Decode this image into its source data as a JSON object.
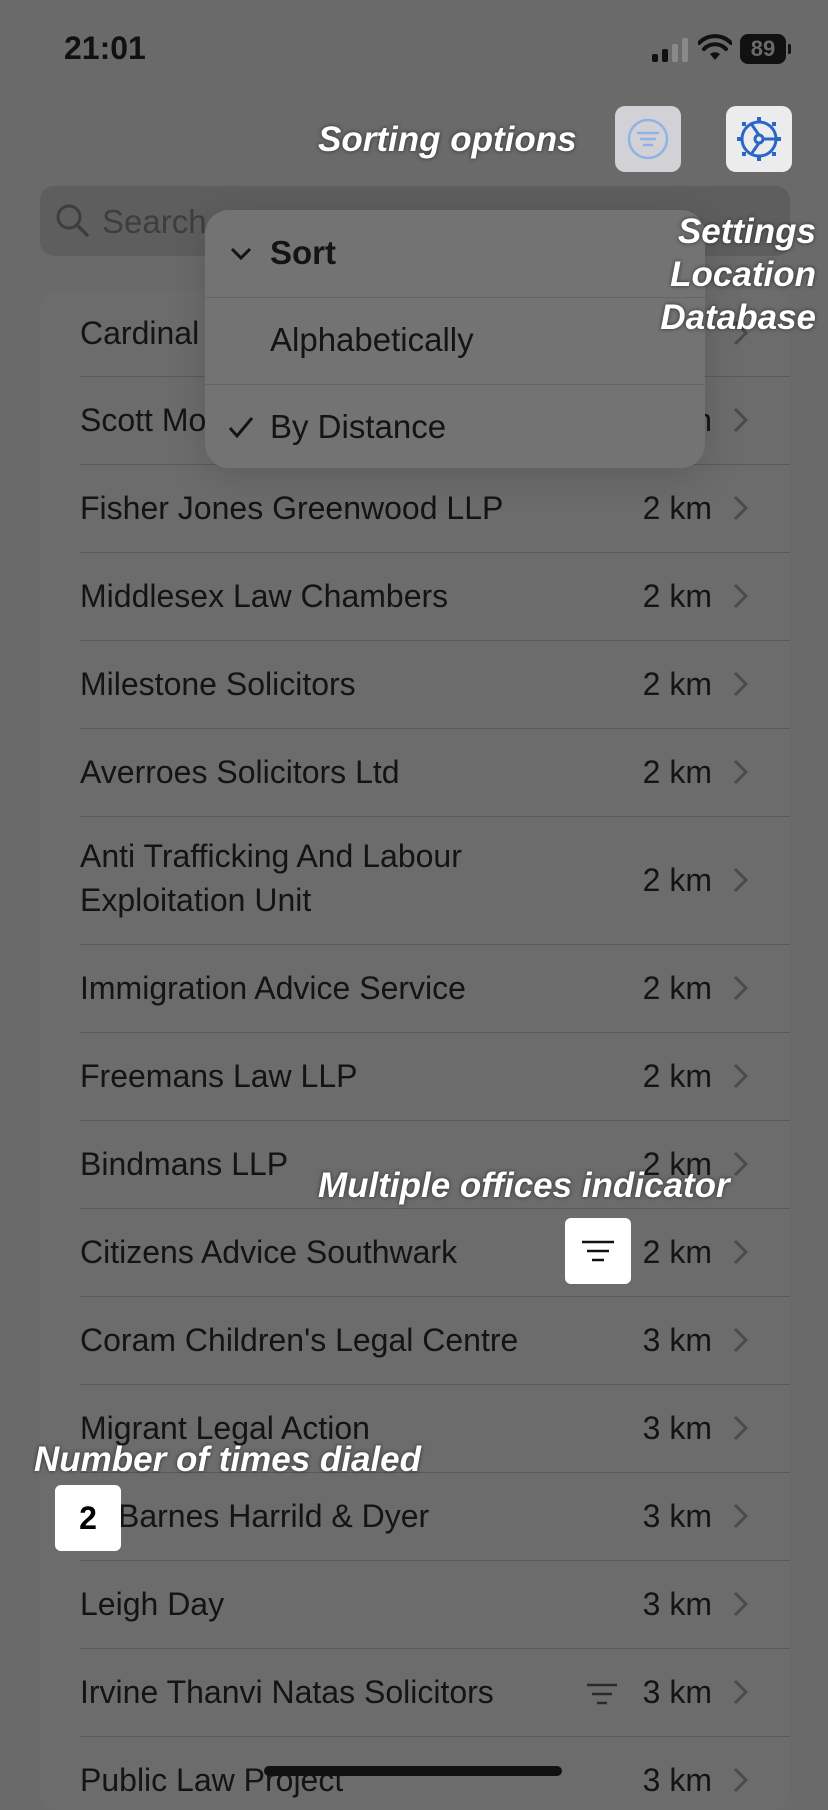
{
  "status_bar": {
    "time": "21:01",
    "battery": "89"
  },
  "toolbar": {
    "sort_icon": "line-3-horizontal-decrease-circle-icon",
    "settings_icon": "gear-icon"
  },
  "annotations": {
    "sorting": "Sorting options",
    "settings_line1": "Settings",
    "settings_line2": "Location",
    "settings_line3": "Database",
    "multiple": "Multiple offices indicator",
    "dialed": "Number of times dialed"
  },
  "search": {
    "placeholder": "Search"
  },
  "menu": {
    "title": "Sort",
    "options": [
      {
        "label": "Alphabetically",
        "selected": false
      },
      {
        "label": "By Distance",
        "selected": true
      }
    ]
  },
  "list": {
    "rows": [
      {
        "name": "Cardinal",
        "distance": ""
      },
      {
        "name": "Scott Mo",
        "distance": "n"
      },
      {
        "name": "Fisher Jones Greenwood LLP",
        "distance": "2 km"
      },
      {
        "name": "Middlesex Law Chambers",
        "distance": "2 km"
      },
      {
        "name": "Milestone Solicitors",
        "distance": "2 km"
      },
      {
        "name": "Averroes Solicitors Ltd",
        "distance": "2 km"
      },
      {
        "name": "Anti Trafficking And Labour",
        "name2": "Exploitation Unit",
        "distance": "2 km"
      },
      {
        "name": "Immigration Advice Service",
        "distance": "2 km"
      },
      {
        "name": "Freemans Law LLP",
        "distance": "2 km"
      },
      {
        "name": "Bindmans LLP",
        "distance": "2 km"
      },
      {
        "name": "Citizens Advice Southwark",
        "distance": "2 km"
      },
      {
        "name": "Coram Children's Legal Centre",
        "distance": "3 km"
      },
      {
        "name": "Migrant Legal Action",
        "distance": "3 km"
      },
      {
        "name": "Barnes Harrild & Dyer",
        "distance": "3 km"
      },
      {
        "name": "Leigh Day",
        "distance": "3 km"
      },
      {
        "name": "Irvine Thanvi Natas Solicitors",
        "distance": "3 km",
        "multiple_offices": true
      },
      {
        "name": "Public Law Project",
        "distance": "3 km"
      }
    ]
  },
  "callouts": {
    "dial_count": "2"
  }
}
